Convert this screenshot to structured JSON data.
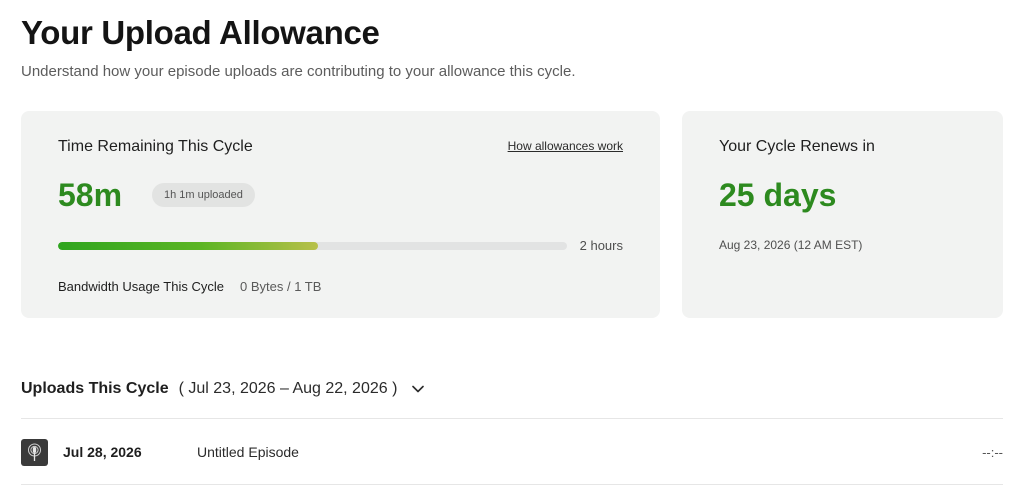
{
  "page": {
    "title": "Your Upload Allowance",
    "subtitle": "Understand how your episode uploads are contributing to your allowance this cycle."
  },
  "time_card": {
    "heading": "Time Remaining This Cycle",
    "help_link": "How allowances work",
    "remaining": "58m",
    "uploaded_pill": "1h 1m uploaded",
    "progress_fraction": 0.51,
    "progress_max": "2 hours",
    "bandwidth_label": "Bandwidth Usage This Cycle",
    "bandwidth_value": "0 Bytes / 1 TB"
  },
  "renew_card": {
    "heading": "Your Cycle Renews in",
    "value": "25 days",
    "date": "Aug 23, 2026  (12 AM EST)"
  },
  "uploads": {
    "title": "Uploads This Cycle",
    "range": "( Jul 23, 2026 – Aug 22, 2026 )",
    "rows": [
      {
        "date": "Jul 28, 2026",
        "title": "Untitled Episode",
        "duration": "--:--"
      }
    ]
  },
  "colors": {
    "accent_green": "#2d8a1f",
    "card_bg": "#f2f3f2"
  }
}
